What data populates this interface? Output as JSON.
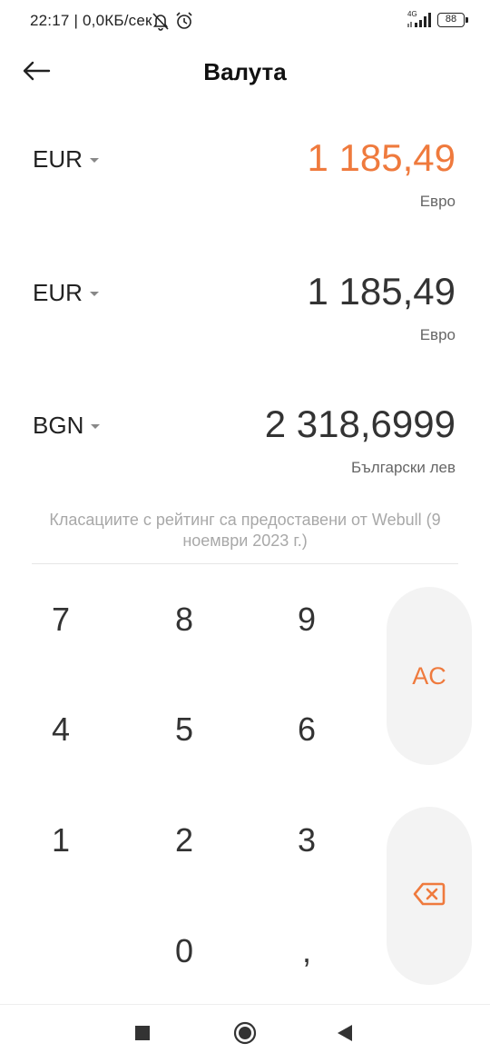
{
  "status_bar": {
    "time_and_speed": "22:17 | 0,0КБ/сек",
    "network": "4G",
    "battery": "88"
  },
  "header": {
    "title": "Валута"
  },
  "rows": [
    {
      "code": "EUR",
      "amount": "1 185,49",
      "name": "Евро",
      "active": true
    },
    {
      "code": "EUR",
      "amount": "1 185,49",
      "name": "Евро",
      "active": false
    },
    {
      "code": "BGN",
      "amount": "2 318,6999",
      "name": "Български лев",
      "active": false
    }
  ],
  "attribution": "Класациите с рейтинг са предоставени от Webull (9 ноември 2023 г.)",
  "keypad": {
    "keys": [
      "7",
      "8",
      "9",
      "4",
      "5",
      "6",
      "1",
      "2",
      "3",
      "0",
      ","
    ],
    "clear_label": "AC"
  },
  "colors": {
    "accent": "#ef7a3d",
    "text": "#333333",
    "muted": "#a8a8a8",
    "side_button_bg": "#f3f3f3"
  },
  "icons": {
    "back": "arrow-left-icon",
    "backspace": "backspace-icon",
    "nav_recent": "square-icon",
    "nav_home": "circle-icon",
    "nav_back": "triangle-left-icon"
  }
}
